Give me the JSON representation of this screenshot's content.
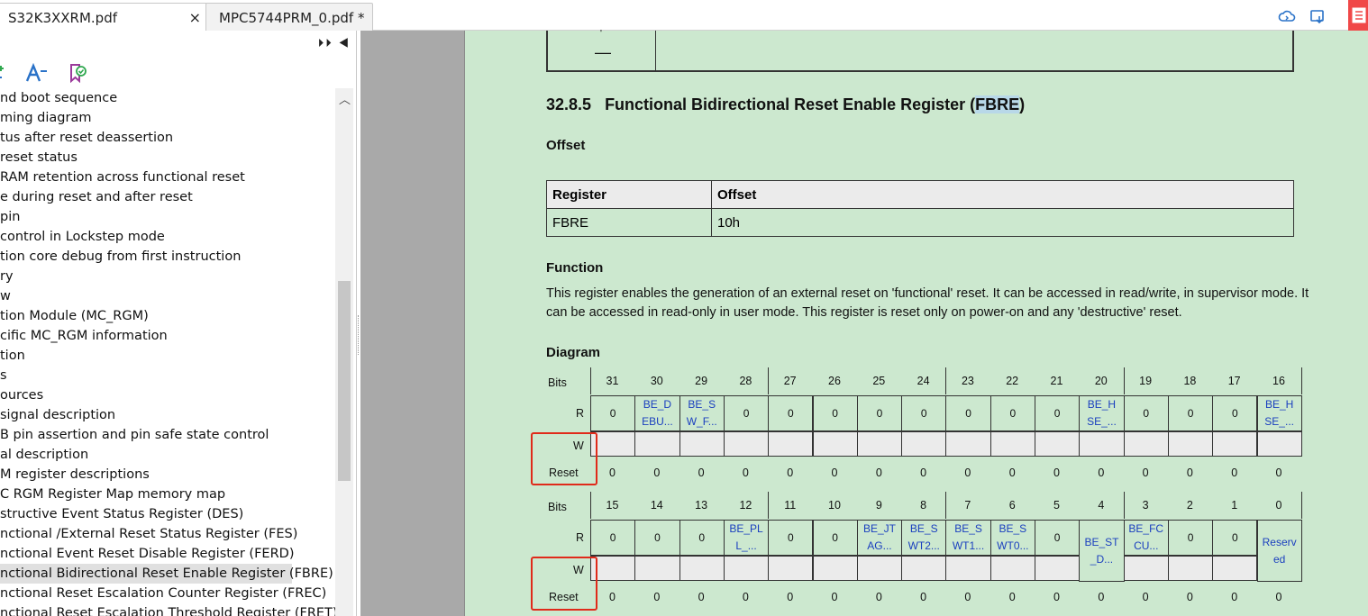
{
  "tabs": [
    {
      "label": "S32K3XXRM.pdf",
      "close": "×"
    },
    {
      "label": "MPC5744PRM_0.pdf *"
    }
  ],
  "panel_controls": "⏵⏵ ◀",
  "outline_items": [
    "nd boot sequence",
    "ming diagram",
    "tus after reset deassertion",
    "reset status",
    "RAM retention across functional reset",
    "e during reset and after reset",
    "pin",
    "control in Lockstep mode",
    "tion core debug from first instruction",
    "ry",
    "w",
    "tion Module (MC_RGM)",
    "cific MC_RGM information",
    "tion",
    "s",
    "ources",
    " signal description",
    "B pin assertion and pin safe state control",
    "al description",
    "M register descriptions",
    "C RGM Register Map memory map",
    "structive Event Status Register (DES)",
    "nctional /External Reset Status Register (FES)",
    "nctional Event Reset Disable Register (FERD)",
    "nctional Bidirectional Reset Enable Register (FBRE)",
    "nctional Reset Escalation Counter Register (FREC)",
    "nctional Reset Escalation Threshold Register (FRET)"
  ],
  "selected_index": 24,
  "document": {
    "prev_dash": "—",
    "section_number": "32.8.5",
    "section_title_pre": "Functional Bidirectional Reset Enable Register (",
    "section_title_hl": "FBRE",
    "section_title_post": ")",
    "offset_heading": "Offset",
    "offset_table": {
      "headers": [
        "Register",
        "Offset"
      ],
      "row": [
        "FBRE",
        "10h"
      ]
    },
    "function_heading": "Function",
    "function_text": "This register enables the generation of an external reset on 'functional' reset. It can be accessed in read/write, in supervisor mode. It can be accessed in read-only in user mode. This register is reset only on power-on and any 'destructive' reset.",
    "diagram_heading": "Diagram",
    "row_labels": {
      "bits": "Bits",
      "r": "R",
      "w": "W",
      "reset": "Reset"
    },
    "upper": {
      "bits": [
        "31",
        "30",
        "29",
        "28",
        "27",
        "26",
        "25",
        "24",
        "23",
        "22",
        "21",
        "20",
        "19",
        "18",
        "17",
        "16"
      ],
      "r": [
        "0",
        "BE_D EBU...",
        "BE_S W_F...",
        "0",
        "0",
        "0",
        "0",
        "0",
        "0",
        "0",
        "0",
        "BE_H SE_...",
        "0",
        "0",
        "0",
        "BE_H SE_..."
      ],
      "reset": [
        "0",
        "0",
        "0",
        "0",
        "0",
        "0",
        "0",
        "0",
        "0",
        "0",
        "0",
        "0",
        "0",
        "0",
        "0",
        "0"
      ]
    },
    "lower": {
      "bits": [
        "15",
        "14",
        "13",
        "12",
        "11",
        "10",
        "9",
        "8",
        "7",
        "6",
        "5",
        "4",
        "3",
        "2",
        "1",
        "0"
      ],
      "r": [
        "0",
        "0",
        "0",
        "BE_PL L_...",
        "0",
        "0",
        "BE_JT AG...",
        "BE_S WT2...",
        "BE_S WT1...",
        "BE_S WT0...",
        "0",
        "BE_ST _D...",
        "BE_FC CU...",
        "0",
        "0",
        "Reserv ed"
      ],
      "reset": [
        "0",
        "0",
        "0",
        "0",
        "0",
        "0",
        "0",
        "0",
        "0",
        "0",
        "0",
        "0",
        "0",
        "0",
        "0",
        "0"
      ]
    }
  },
  "colors": {
    "page": "#cce8cf",
    "link": "#1a3fbf",
    "annotation": "#e02a1a"
  }
}
